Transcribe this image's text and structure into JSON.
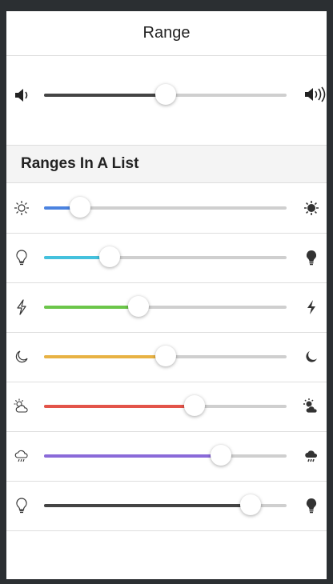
{
  "header": {
    "title": "Range"
  },
  "volume": {
    "value": 50,
    "fill_color": "#444444",
    "left_icon": "volume-low-icon",
    "right_icon": "volume-high-icon"
  },
  "list": {
    "title": "Ranges In A List",
    "items": [
      {
        "value": 15,
        "color": "#4b83e0",
        "left_icon": "sun-outline-icon",
        "right_icon": "sun-filled-icon"
      },
      {
        "value": 27,
        "color": "#44c1dd",
        "left_icon": "bulb-outline-icon",
        "right_icon": "bulb-filled-icon"
      },
      {
        "value": 39,
        "color": "#6cc64a",
        "left_icon": "bolt-outline-icon",
        "right_icon": "bolt-filled-icon"
      },
      {
        "value": 50,
        "color": "#e8b244",
        "left_icon": "moon-outline-icon",
        "right_icon": "moon-filled-icon"
      },
      {
        "value": 62,
        "color": "#e3544a",
        "left_icon": "partly-sunny-outline-icon",
        "right_icon": "partly-sunny-filled-icon"
      },
      {
        "value": 73,
        "color": "#8a6ad9",
        "left_icon": "rainy-outline-icon",
        "right_icon": "rainy-filled-icon"
      },
      {
        "value": 85,
        "color": "#444444",
        "left_icon": "bulb-outline-icon",
        "right_icon": "bulb-filled-icon"
      }
    ]
  }
}
